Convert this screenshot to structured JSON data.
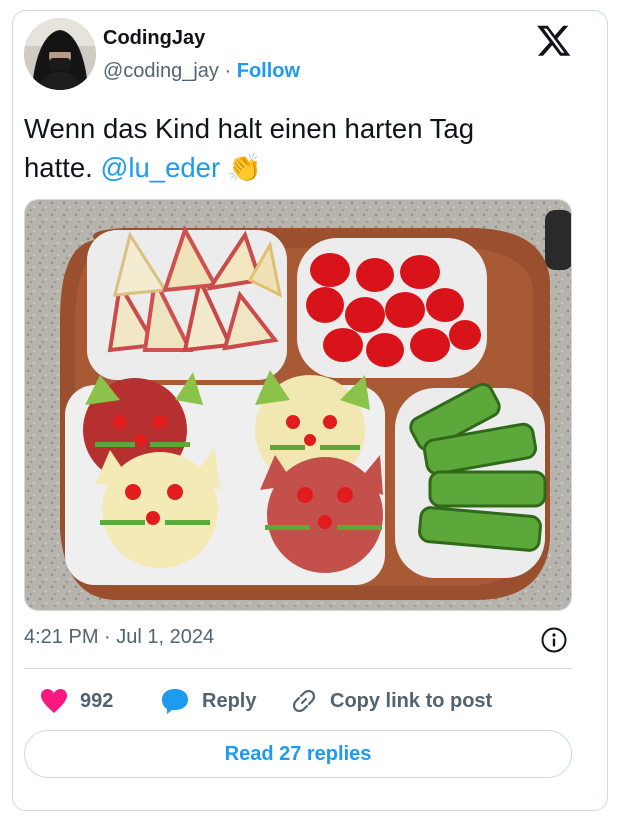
{
  "author": {
    "name": "CodingJay",
    "handle": "@coding_jay",
    "separator": "·",
    "follow_label": "Follow"
  },
  "tweet": {
    "text_lines": [
      "Wenn das Kind halt einen harten Tag",
      "hatte."
    ],
    "mention": "@lu_eder",
    "emoji": "👏",
    "timestamp": "4:21 PM · Jul 1, 2024"
  },
  "actions": {
    "likes_count": "992",
    "reply_label": "Reply",
    "copy_link_label": "Copy link to post"
  },
  "read_replies_label": "Read 27 replies",
  "icons": {
    "like": "heart-icon",
    "reply": "speech-bubble-icon",
    "copy": "link-icon",
    "info": "info-icon",
    "logo": "x-logo-icon"
  },
  "colors": {
    "accent": "#1d9bf0",
    "like": "#f91880",
    "secondary_text": "#536471",
    "border": "#cfd9de"
  }
}
